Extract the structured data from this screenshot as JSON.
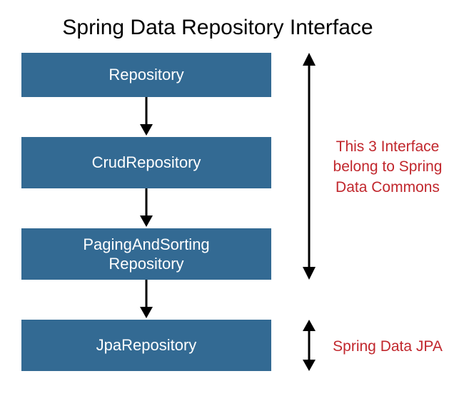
{
  "title": "Spring Data Repository Interface",
  "boxes": {
    "b1": "Repository",
    "b2": "CrudRepository",
    "b3": "PagingAndSorting\nRepository",
    "b4": "JpaRepository"
  },
  "annotations": {
    "a1": "This 3 Interface\nbelong to Spring\nData Commons",
    "a2": "Spring Data JPA"
  },
  "colors": {
    "box_bg": "#336a93",
    "box_text": "#ffffff",
    "annotation_text": "#c1272d",
    "arrow": "#000000"
  }
}
